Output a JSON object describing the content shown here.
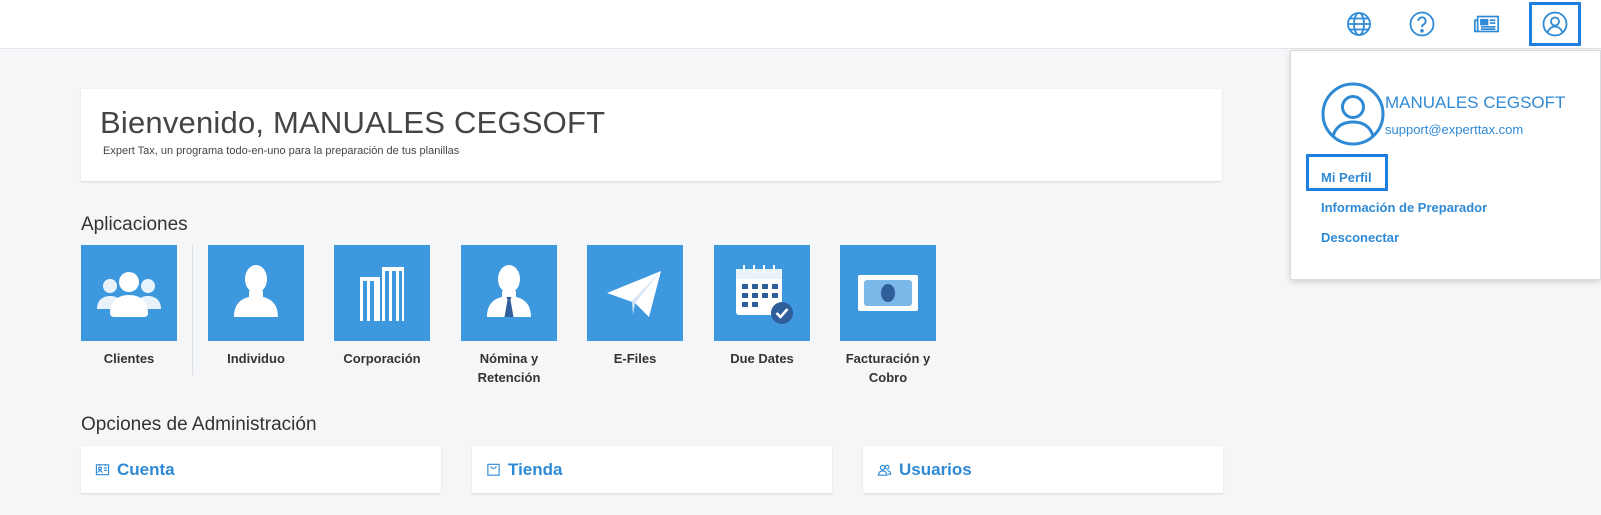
{
  "topbar": {
    "icons": [
      "globe-icon",
      "help-icon",
      "news-icon",
      "user-icon"
    ]
  },
  "welcome": {
    "title": "Bienvenido, MANUALES CEGSOFT",
    "subtitle": "Expert Tax, un programa todo-en-uno para la preparación de tus planillas"
  },
  "apps": {
    "heading": "Aplicaciones",
    "items": [
      {
        "label": "Clientes",
        "icon": "clients-icon"
      },
      {
        "label": "Individuo",
        "icon": "individual-icon"
      },
      {
        "label": "Corporación",
        "icon": "corporation-icon"
      },
      {
        "label": "Nómina y Retención",
        "icon": "payroll-icon"
      },
      {
        "label": "E-Files",
        "icon": "efiles-icon"
      },
      {
        "label": "Due Dates",
        "icon": "calendar-icon"
      },
      {
        "label": "Facturación y Cobro",
        "icon": "billing-icon"
      }
    ]
  },
  "admin": {
    "heading": "Opciones de Administración",
    "items": [
      {
        "label": "Cuenta",
        "icon": "account-card-icon"
      },
      {
        "label": "Tienda",
        "icon": "store-icon"
      },
      {
        "label": "Usuarios",
        "icon": "users-icon"
      }
    ]
  },
  "user_menu": {
    "name": "MANUALES CEGSOFT",
    "email": "support@experttax.com",
    "items": [
      "Mi Perfil",
      "Información de Preparador",
      "Desconectar"
    ]
  },
  "colors": {
    "accent": "#2f8ad5",
    "tile": "#3d98de",
    "focus": "#1e7fe0"
  }
}
